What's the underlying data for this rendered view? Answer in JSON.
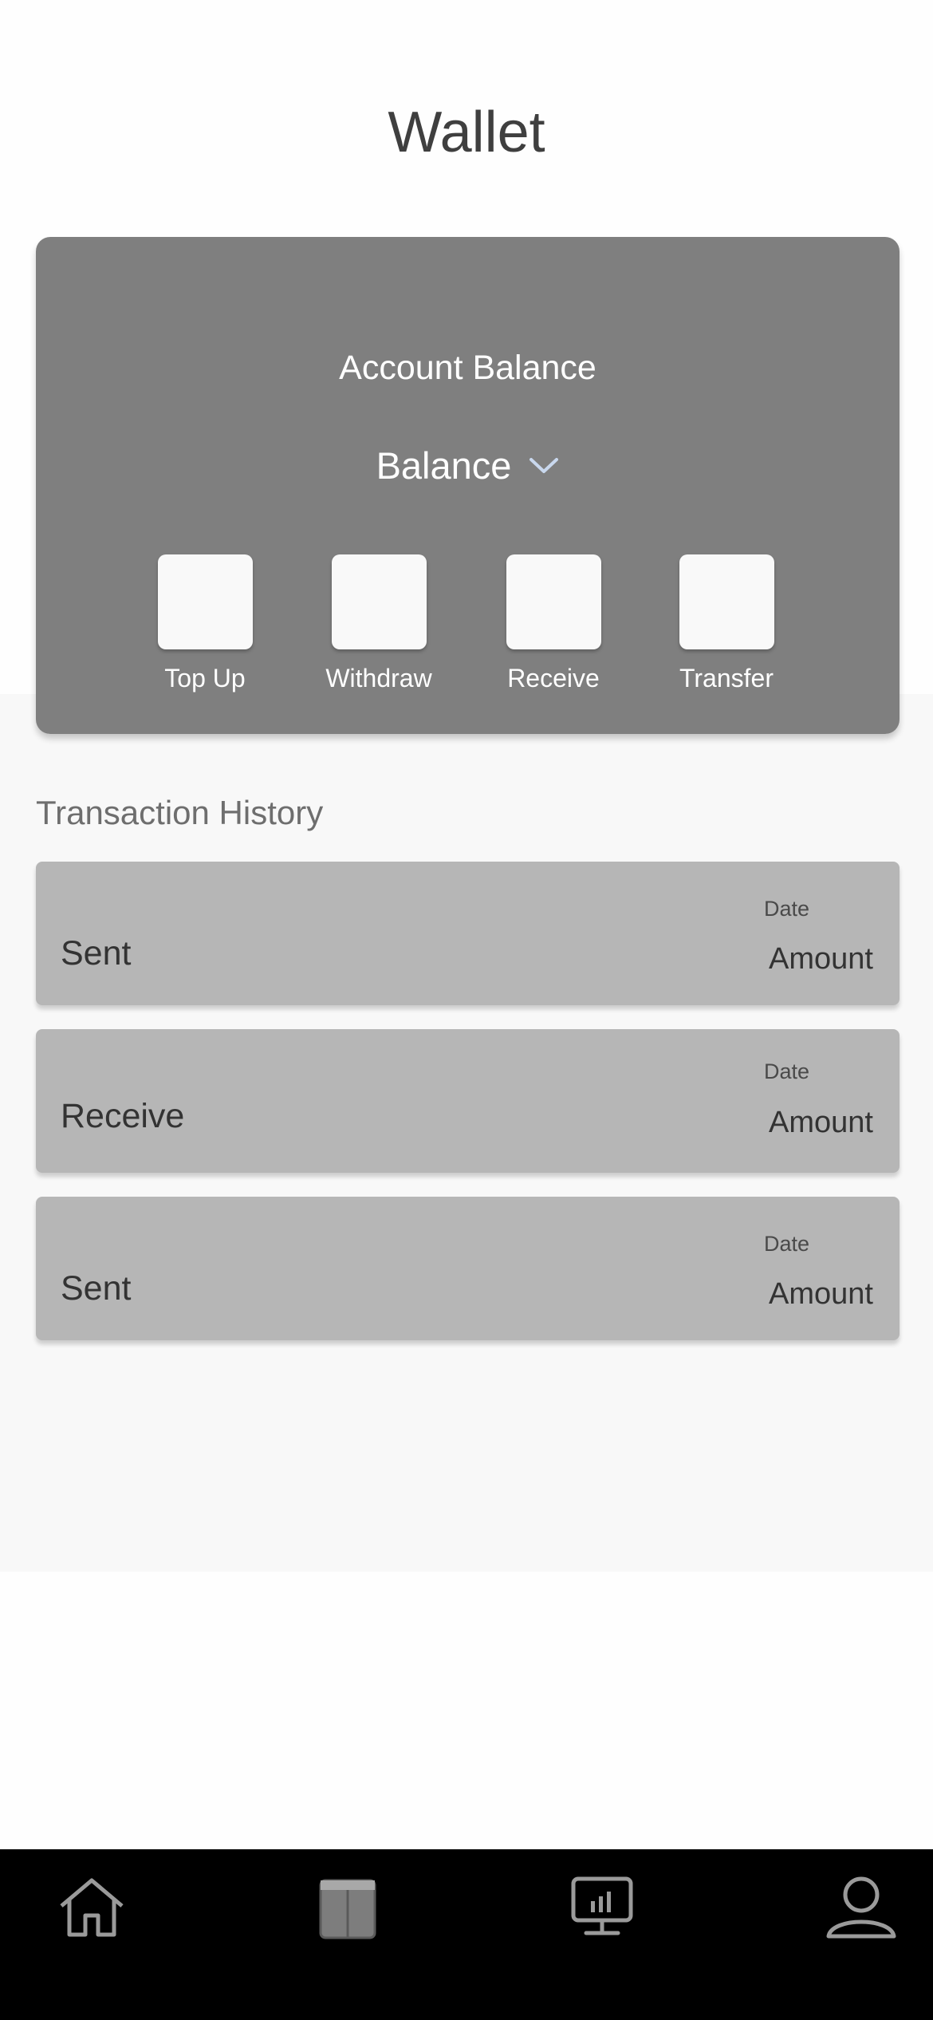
{
  "header": {
    "title": "Wallet"
  },
  "balance_card": {
    "heading": "Account Balance",
    "balance_label": "Balance",
    "actions": [
      {
        "label": "Top Up"
      },
      {
        "label": "Withdraw"
      },
      {
        "label": "Receive"
      },
      {
        "label": "Transfer"
      }
    ]
  },
  "history": {
    "title": "Transaction History",
    "rows": [
      {
        "type": "Sent",
        "date": "Date",
        "amount": "Amount"
      },
      {
        "type": "Receive",
        "date": "Date",
        "amount": "Amount"
      },
      {
        "type": "Sent",
        "date": "Date",
        "amount": "Amount"
      }
    ]
  },
  "nav": {
    "items": [
      {
        "icon": "home-icon"
      },
      {
        "icon": "wallet-icon"
      },
      {
        "icon": "analytics-monitor-icon"
      },
      {
        "icon": "profile-icon"
      }
    ]
  },
  "colors": {
    "card": "#787878",
    "tile": "#f9f9f9",
    "row": "#b6b6b6",
    "nav_bg": "#000000",
    "chevron": "#c9d8ee"
  }
}
